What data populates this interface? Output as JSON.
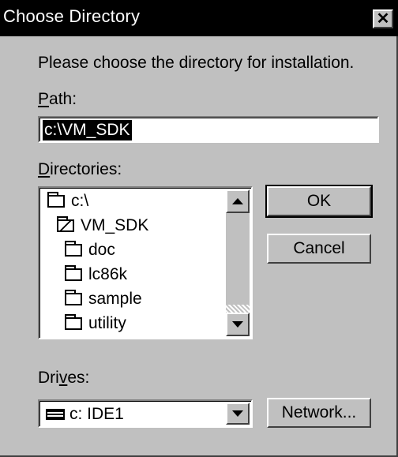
{
  "window": {
    "title": "Choose Directory",
    "close_glyph": "✕"
  },
  "prompt": "Please choose the directory for installation.",
  "path": {
    "label_accel": "P",
    "label_rest": "ath:",
    "value": "c:\\VM_SDK"
  },
  "directories": {
    "label_accel": "D",
    "label_rest": "irectories:",
    "items": [
      {
        "name": "c:\\",
        "icon": "open-folder-icon"
      },
      {
        "name": "VM_SDK",
        "icon": "open-folder-icon"
      },
      {
        "name": "doc",
        "icon": "folder-icon"
      },
      {
        "name": "lc86k",
        "icon": "folder-icon"
      },
      {
        "name": "sample",
        "icon": "folder-icon"
      },
      {
        "name": "utility",
        "icon": "folder-icon"
      }
    ]
  },
  "buttons": {
    "ok": "OK",
    "cancel": "Cancel",
    "network": "Network..."
  },
  "drives": {
    "label_pre": "Dri",
    "label_accel": "v",
    "label_post": "es:",
    "selected": "c: IDE1",
    "icon": "drive-icon"
  },
  "colors": {
    "titlebar": "#000000",
    "face": "#c0c0c0",
    "selection": "#000000"
  }
}
